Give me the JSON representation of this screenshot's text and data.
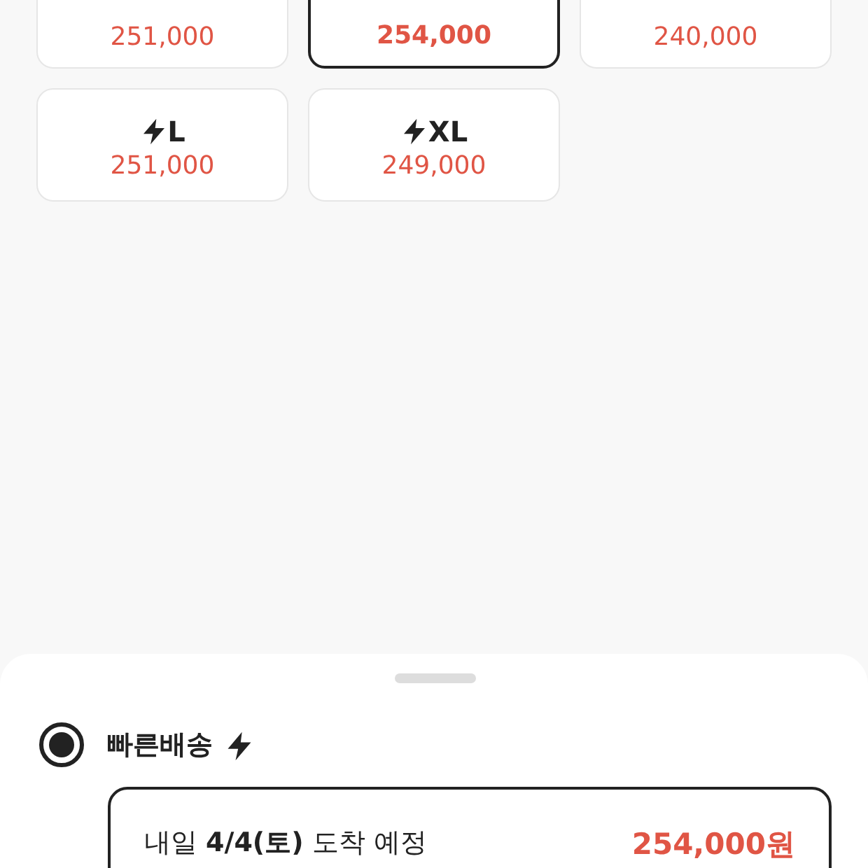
{
  "sizes": [
    {
      "price": "251,000",
      "selected": false
    },
    {
      "price": "254,000",
      "selected": true
    },
    {
      "price": "240,000",
      "selected": false
    },
    {
      "label": "L",
      "price": "251,000",
      "selected": false
    },
    {
      "label": "XL",
      "price": "249,000",
      "selected": false
    }
  ],
  "delivery": {
    "label": "빠른배송",
    "selected": true,
    "arrival": "내일 **4/4(토)** 도착 예정",
    "price": "254,000원"
  }
}
